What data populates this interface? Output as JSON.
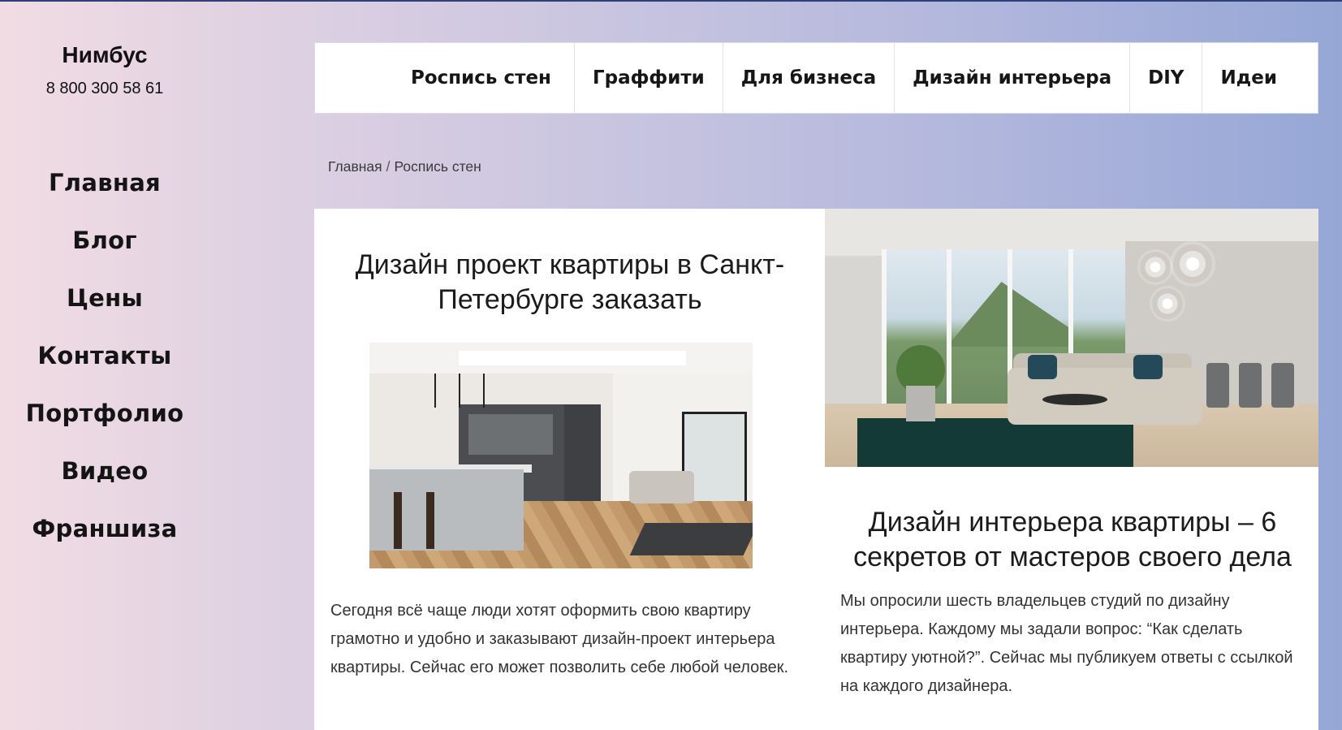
{
  "site": {
    "brand": "Нимбус",
    "phone": "8 800 300 58 61"
  },
  "sidebar": {
    "items": [
      {
        "label": "Главная"
      },
      {
        "label": "Блог"
      },
      {
        "label": "Цены"
      },
      {
        "label": "Контакты"
      },
      {
        "label": "Портфолио"
      },
      {
        "label": "Видео"
      },
      {
        "label": "Франшиза"
      }
    ]
  },
  "topmenu": {
    "items": [
      {
        "label": "Роспись стен"
      },
      {
        "label": "Граффити"
      },
      {
        "label": "Для бизнеса"
      },
      {
        "label": "Дизайн интерьера"
      },
      {
        "label": "DIY"
      },
      {
        "label": "Идеи"
      }
    ]
  },
  "breadcrumb": {
    "home": "Главная",
    "separator": "/",
    "current": "Роспись стен"
  },
  "posts": [
    {
      "title": "Дизайн проект квартиры в Санкт-Петербурге заказать",
      "image_icon": "kitchen-interior-photo",
      "excerpt": "Сегодня всё чаще люди хотят оформить свою квартиру грамотно и удобно и заказывают дизайн-проект интерьера квартиры. Сейчас его может позволить себе любой человек."
    },
    {
      "title": "Дизайн интерьера квартиры – 6 секретов от мастеров своего дела",
      "image_icon": "living-room-interior-photo",
      "excerpt": "Мы опросили шесть владельцев студий по дизайну интерьера. Каждому мы задали вопрос: “Как сделать квартиру уютной?”. Сейчас мы публикуем ответы с ссылкой на каждого дизайнера."
    }
  ],
  "colors": {
    "gradient_left": "#f1dce3",
    "gradient_right": "#96a7d6",
    "top_line": "#2f3f78",
    "card_bg": "#ffffff"
  }
}
